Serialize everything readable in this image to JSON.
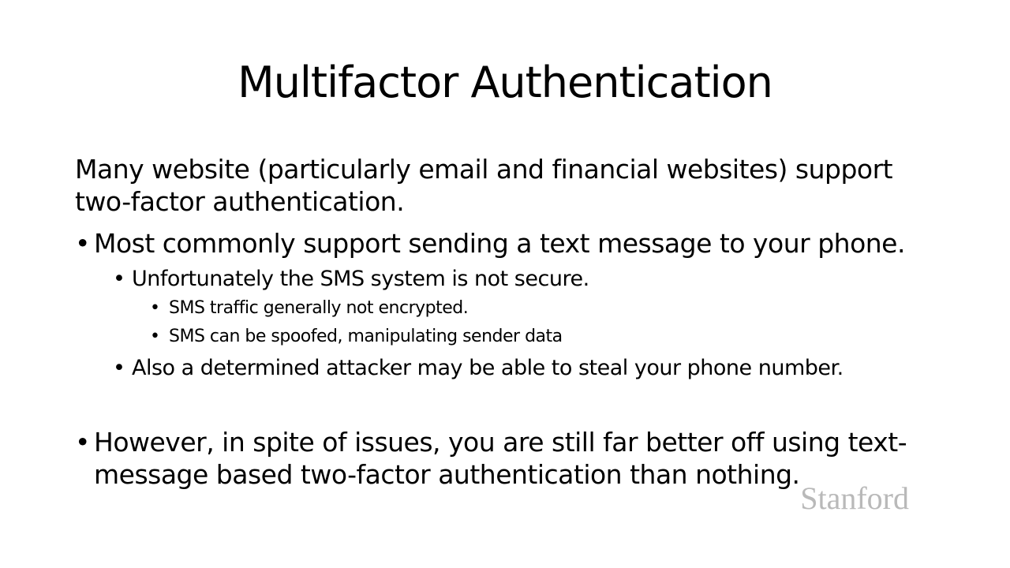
{
  "slide": {
    "title": "Multifactor Authentication",
    "intro": "Many website (particularly email and financial websites) support two-factor authentication.",
    "bullets": {
      "b1": "Most commonly support sending a text message to your phone.",
      "b1_1": "Unfortunately the SMS system is not secure.",
      "b1_1_1": "SMS traffic generally not encrypted.",
      "b1_1_2": "SMS can be spoofed, manipulating sender data",
      "b1_2": "Also a determined attacker may be able to steal your phone number.",
      "b2": "However, in spite of issues, you are still far better off using text-message based two-factor authentication than nothing."
    },
    "bullet_glyph": "•",
    "watermark": "Stanford"
  }
}
